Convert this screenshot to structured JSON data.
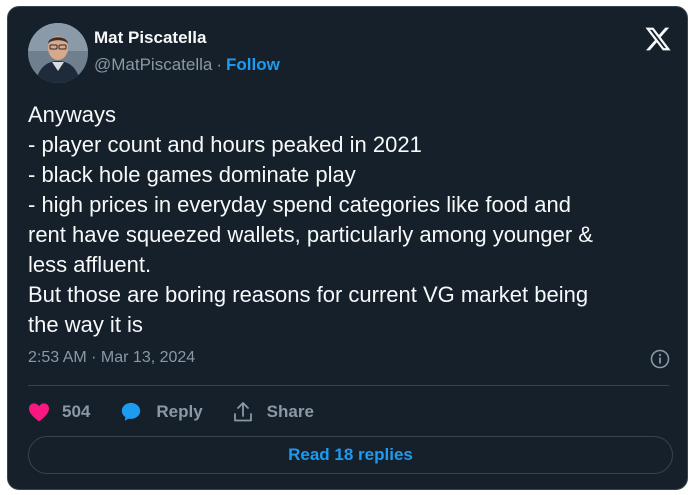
{
  "author": {
    "name": "Mat Piscatella",
    "handle": "@MatPiscatella",
    "separator": "·",
    "follow_label": "Follow"
  },
  "tweet": {
    "lines": [
      "Anyways",
      "- player count and hours peaked in 2021",
      "- black hole games dominate play",
      "- high prices in everyday spend categories like food and",
      "rent have squeezed wallets, particularly among younger &",
      "less affluent.",
      "But those are boring reasons for current VG market being",
      "the way it is"
    ],
    "timestamp": "2:53 AM · Mar 13, 2024"
  },
  "actions": {
    "like_count": "504",
    "reply_label": "Reply",
    "share_label": "Share"
  },
  "read_replies_label": "Read 18 replies",
  "icons": {
    "brand": "x-logo-icon",
    "info": "info-icon",
    "like": "heart-icon",
    "reply": "speech-bubble-icon",
    "share": "share-upload-icon"
  },
  "colors": {
    "background": "#15202b",
    "border": "#38444d",
    "text_primary": "#f7f9f9",
    "text_secondary": "#8b98a5",
    "accent": "#1d9bf0",
    "like": "#f91880"
  }
}
